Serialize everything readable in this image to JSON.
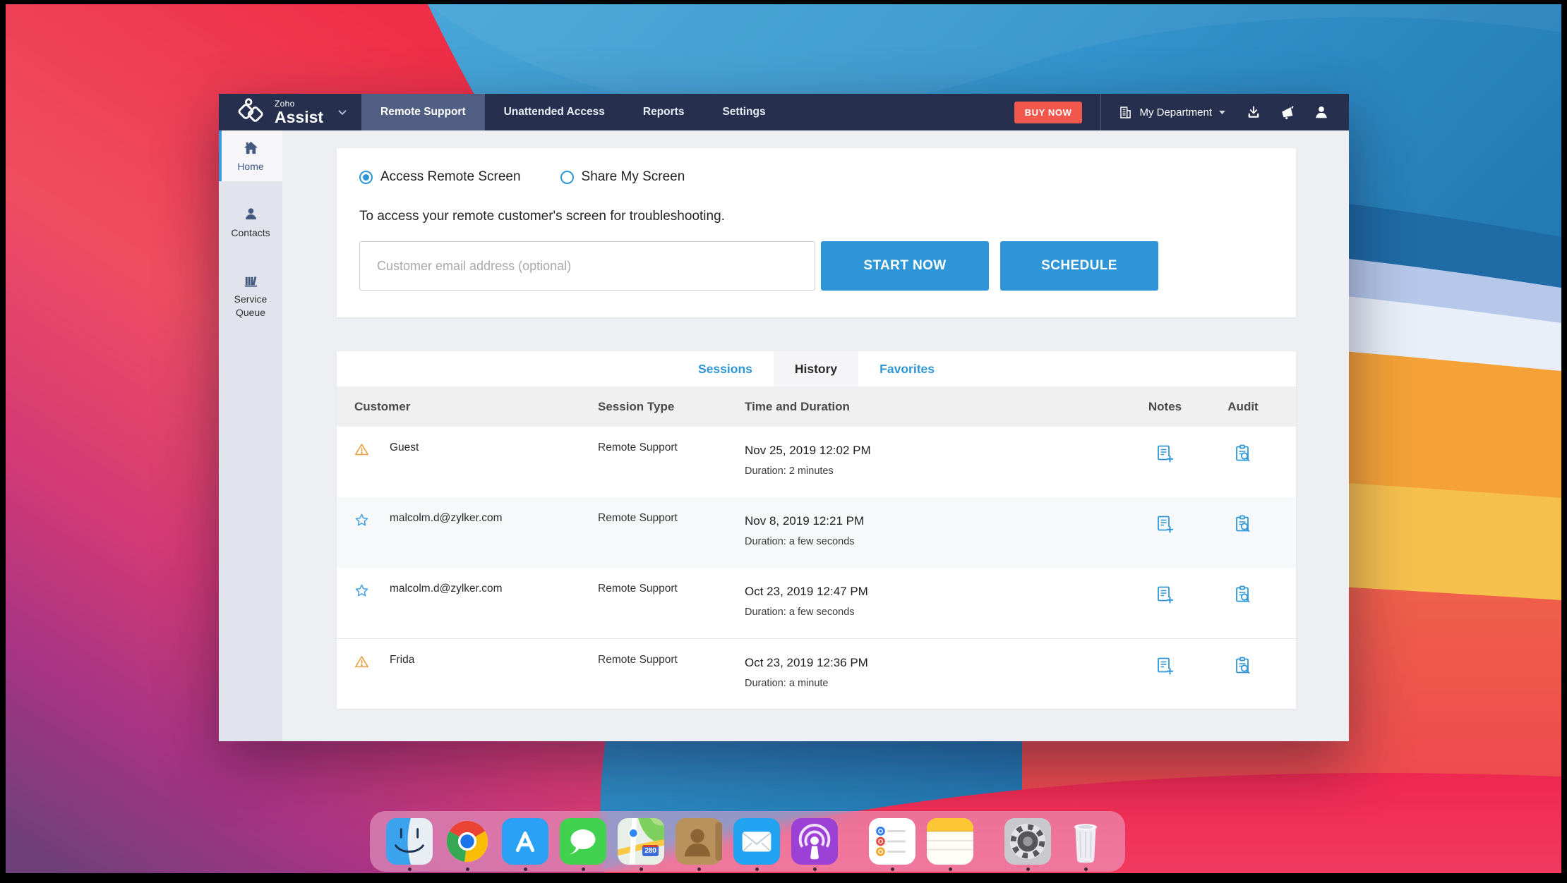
{
  "header": {
    "logo": {
      "brand": "Zoho",
      "product": "Assist"
    },
    "nav_items": [
      {
        "label": "Remote Support",
        "name": "nav-remote-support",
        "active": "true"
      },
      {
        "label": "Unattended Access",
        "name": "nav-unattended-access",
        "active": "false"
      },
      {
        "label": "Reports",
        "name": "nav-reports",
        "active": "false"
      },
      {
        "label": "Settings",
        "name": "nav-settings",
        "active": "false"
      }
    ],
    "buy_now_label": "BUY NOW",
    "department_label": "My Department"
  },
  "sidebar": {
    "items": [
      {
        "label": "Home",
        "name": "sidebar-item-home",
        "icon": "home",
        "active": "true"
      },
      {
        "label": "Contacts",
        "name": "sidebar-item-contacts",
        "icon": "contacts",
        "active": "false"
      },
      {
        "label": "Service Queue",
        "name": "sidebar-item-service-queue",
        "icon": "service-queue",
        "active": "false"
      }
    ]
  },
  "session_launcher": {
    "modes": [
      {
        "label": "Access Remote Screen",
        "name": "radio-access-remote-screen",
        "selected": "true"
      },
      {
        "label": "Share My Screen",
        "name": "radio-share-my-screen",
        "selected": "false"
      }
    ],
    "description": "To access your remote customer's screen for troubleshooting.",
    "email_placeholder": "Customer email address (optional)",
    "start_label": "START NOW",
    "schedule_label": "SCHEDULE"
  },
  "sessions_panel": {
    "tabs": [
      {
        "label": "Sessions",
        "name": "tab-sessions",
        "active": "false"
      },
      {
        "label": "History",
        "name": "tab-history",
        "active": "true"
      },
      {
        "label": "Favorites",
        "name": "tab-favorites",
        "active": "false"
      }
    ],
    "columns": {
      "customer": "Customer",
      "session_type": "Session Type",
      "time": "Time and Duration",
      "notes": "Notes",
      "audit": "Audit"
    },
    "rows": [
      {
        "icon": "alert",
        "customer": "Guest",
        "session_type": "Remote Support",
        "time": "Nov 25, 2019 12:02 PM",
        "duration": "Duration: 2 minutes",
        "shaded": "false",
        "divider": "false"
      },
      {
        "icon": "star",
        "customer": "malcolm.d@zylker.com",
        "session_type": "Remote Support",
        "time": "Nov 8, 2019 12:21 PM",
        "duration": "Duration: a few seconds",
        "shaded": "true",
        "divider": "false"
      },
      {
        "icon": "star",
        "customer": "malcolm.d@zylker.com",
        "session_type": "Remote Support",
        "time": "Oct 23, 2019 12:47 PM",
        "duration": "Duration: a few seconds",
        "shaded": "false",
        "divider": "false"
      },
      {
        "icon": "alert",
        "customer": "Frida",
        "session_type": "Remote Support",
        "time": "Oct 23, 2019 12:36 PM",
        "duration": "Duration: a minute",
        "shaded": "false",
        "divider": "true"
      }
    ]
  },
  "dock": {
    "items": [
      {
        "app": "finder",
        "name": "dock-app-finder",
        "badge": ""
      },
      {
        "app": "chrome",
        "name": "dock-app-chrome",
        "badge": ""
      },
      {
        "app": "app-store",
        "name": "dock-app-app-store",
        "badge": ""
      },
      {
        "app": "messages",
        "name": "dock-app-messages",
        "badge": ""
      },
      {
        "app": "maps",
        "name": "dock-app-maps",
        "badge": "280"
      },
      {
        "app": "contacts",
        "name": "dock-app-contacts",
        "badge": ""
      },
      {
        "app": "mail",
        "name": "dock-app-mail",
        "badge": ""
      },
      {
        "app": "podcasts",
        "name": "dock-app-podcasts",
        "badge": ""
      },
      {
        "app": "reminders",
        "name": "dock-app-reminders",
        "badge": ""
      },
      {
        "app": "notes",
        "name": "dock-app-notes",
        "badge": ""
      },
      {
        "app": "system-preferences",
        "name": "dock-app-system-preferences",
        "badge": ""
      },
      {
        "app": "trash",
        "name": "dock-trash",
        "badge": ""
      }
    ]
  },
  "colors": {
    "accent_blue": "#2e96d6",
    "header_navy": "#26304e",
    "active_nav": "#505e83",
    "buy_now_red": "#f2574d",
    "alert_orange": "#f09a3e",
    "star_blue": "#4aa3e2"
  }
}
